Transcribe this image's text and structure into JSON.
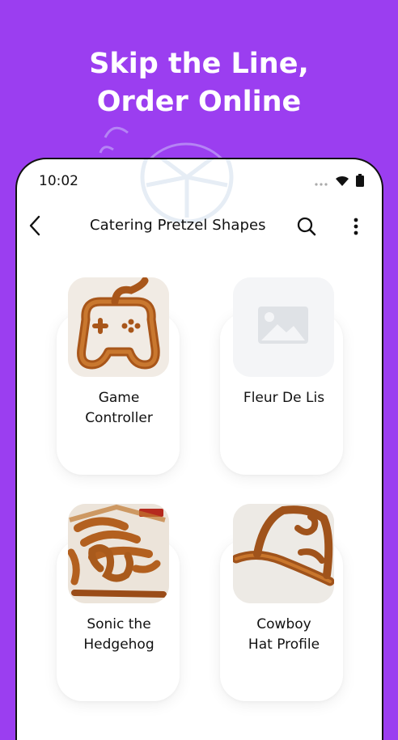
{
  "promo": {
    "headline_line1": "Skip the Line,",
    "headline_line2": "Order Online",
    "background_color": "#9b3ef0"
  },
  "status_bar": {
    "time": "10:02",
    "icons": [
      "dots-icon",
      "wifi-icon",
      "battery-icon"
    ]
  },
  "app_bar": {
    "title": "Catering Pretzel Shapes",
    "back_icon": "chevron-left-icon",
    "search_icon": "search-icon",
    "more_icon": "more-vertical-icon"
  },
  "products": [
    {
      "name": "Game\nController",
      "image": "game-controller-pretzel"
    },
    {
      "name": "Fleur De Lis",
      "image": "image-placeholder-icon"
    },
    {
      "name": "Sonic the\nHedgehog",
      "image": "sonic-pretzel"
    },
    {
      "name": "Cowboy\nHat Profile",
      "image": "cowboy-hat-pretzel"
    }
  ]
}
